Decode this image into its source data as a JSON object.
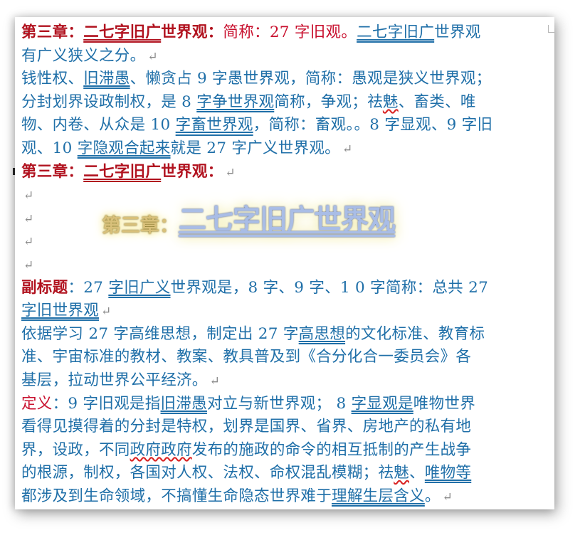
{
  "document": {
    "lines": [
      [
        {
          "t": "第三章：",
          "c": "dred"
        },
        {
          "t": "二七字旧广",
          "c": "dred dbl"
        },
        {
          "t": "世界观：",
          "c": "dred"
        },
        {
          "t": "简称：27 字旧观。",
          "c": "red"
        },
        {
          "t": "二七字旧广",
          "c": "dbl"
        },
        {
          "t": "世界观"
        }
      ],
      [
        {
          "t": "有广义狭义之分。"
        },
        {
          "t": "↵",
          "c": "pm"
        }
      ],
      [
        {
          "t": "钱性权、"
        },
        {
          "t": "旧滞愚",
          "c": "dbl"
        },
        {
          "t": "、懒贪占 9 字愚世界观，简称：愚观是狭义世界观；"
        }
      ],
      [
        {
          "t": "分封划界设政制权，是 8 "
        },
        {
          "t": "字争世界观",
          "c": "dbl"
        },
        {
          "t": "简称，争观；祛"
        },
        {
          "t": "魅",
          "c": "sq"
        },
        {
          "t": "、畜类、唯"
        }
      ],
      [
        {
          "t": "物、内卷、从众是 10 "
        },
        {
          "t": "字畜世界观",
          "c": "dbl"
        },
        {
          "t": "，简称：畜观。。8 字显观、9 字旧"
        }
      ],
      [
        {
          "t": "观、10 "
        },
        {
          "t": "字隐观合起来",
          "c": "dbl"
        },
        {
          "t": "就是 27 字广义世界观。"
        },
        {
          "t": "↵",
          "c": "pm"
        }
      ],
      [
        {
          "t": "第三章：",
          "c": "dred"
        },
        {
          "t": "二七字旧广",
          "c": "dred dbl"
        },
        {
          "t": "世界观：",
          "c": "dred"
        },
        {
          "t": "↵",
          "c": "pm"
        }
      ],
      [
        {
          "t": "↵",
          "c": "pm"
        }
      ],
      [
        {
          "t": "↵",
          "c": "pm"
        }
      ],
      [
        {
          "t": "↵",
          "c": "pm"
        }
      ],
      [
        {
          "t": "↵",
          "c": "pm"
        }
      ],
      [
        {
          "t": "副标题",
          "c": "dred"
        },
        {
          "t": "：27 "
        },
        {
          "t": "字旧广义",
          "c": "dbl"
        },
        {
          "t": "世界观是，8 字、9 字、1 0 字简称：总共 27"
        }
      ],
      [
        {
          "t": "字旧世界观",
          "c": "dbl"
        },
        {
          "t": "↵",
          "c": "pm"
        }
      ],
      [
        {
          "t": "依据学习 27 字高维思想，制定出 27 字"
        },
        {
          "t": "高思想",
          "c": "dbl"
        },
        {
          "t": "的文化标准、教育标"
        }
      ],
      [
        {
          "t": "准、宇宙标准的教材、教案、教具普及到《合分化合一委员会》各"
        }
      ],
      [
        {
          "t": "基层，拉动世界公平经济。"
        },
        {
          "t": "↵",
          "c": "pm"
        }
      ],
      [
        {
          "t": "定义",
          "c": "red"
        },
        {
          "t": "：9 字旧观是指"
        },
        {
          "t": "旧滞愚",
          "c": "dbl"
        },
        {
          "t": "对立与新世界观；  8 "
        },
        {
          "t": "字显观是",
          "c": "dbl"
        },
        {
          "t": "唯物世界"
        }
      ],
      [
        {
          "t": "看得见摸得着的分封是特权，划界是国界、省界、房地产的私有地"
        }
      ],
      [
        {
          "t": "界，设政，不同"
        },
        {
          "t": "政府政府",
          "c": "sq"
        },
        {
          "t": "发布的施政的命令的相互抵制的产生战争"
        }
      ],
      [
        {
          "t": "的根源，制权，各国对人权、法权、命权混乱模糊；祛"
        },
        {
          "t": "魅",
          "c": "sq"
        },
        {
          "t": "、"
        },
        {
          "t": "唯物等",
          "c": "dbl"
        }
      ],
      [
        {
          "t": "都涉及到生命领域，不搞懂生命隐态世界难于"
        },
        {
          "t": "理解生层含义",
          "c": "dbl"
        },
        {
          "t": "。"
        },
        {
          "t": "↵",
          "c": "pm"
        }
      ]
    ],
    "banner": {
      "prefix": "第三章：",
      "title": "二七字旧广世界观"
    }
  }
}
